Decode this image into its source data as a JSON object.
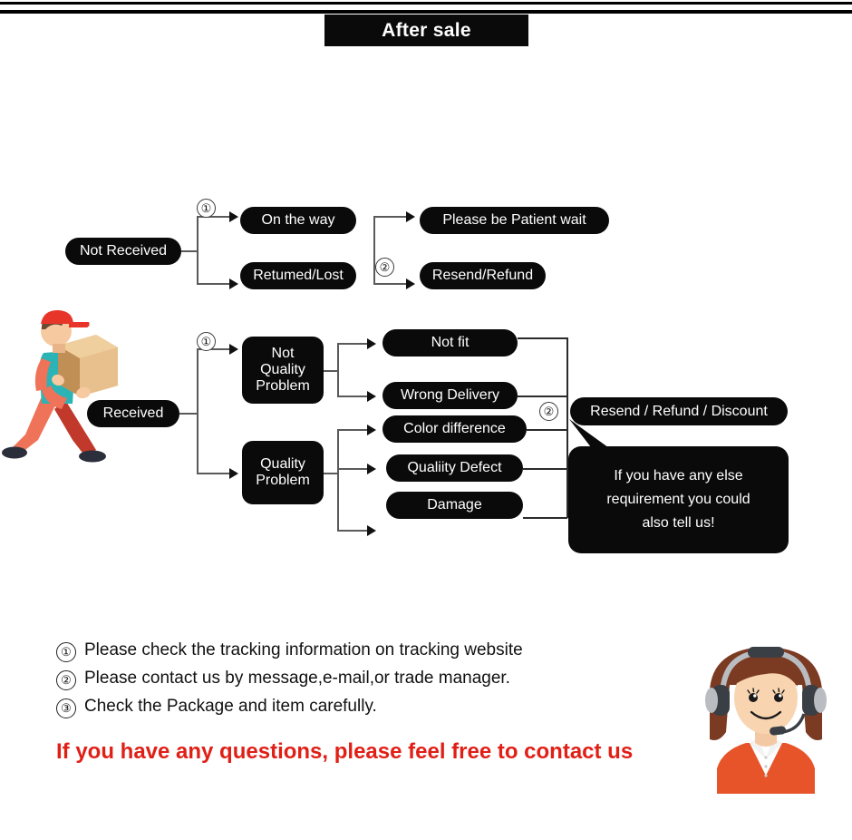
{
  "header": {
    "title": "After sale"
  },
  "flow": {
    "not_received": {
      "label": "Not Received",
      "marker": "①",
      "branches": [
        {
          "label": "On the way"
        },
        {
          "label": "Retumed/Lost"
        }
      ],
      "outcome_marker": "②",
      "outcomes": [
        {
          "label": "Please be Patient wait"
        },
        {
          "label": "Resend/Refund"
        }
      ]
    },
    "received": {
      "label": "Received",
      "marker": "①",
      "categories": [
        {
          "label": "Not Quality Problem",
          "lines": [
            "Not",
            "Quality",
            "Problem"
          ]
        },
        {
          "label": "Quality Problem",
          "lines": [
            "Quality",
            "Problem"
          ]
        }
      ],
      "not_quality_issues": [
        {
          "label": "Not fit"
        },
        {
          "label": "Wrong Delivery"
        }
      ],
      "quality_issues": [
        {
          "label": "Color difference"
        },
        {
          "label": "Qualiity Defect"
        },
        {
          "label": "Damage"
        }
      ],
      "resolution_marker": "②",
      "resolution": {
        "label": "Resend / Refund / Discount"
      }
    },
    "bubble": {
      "lines": [
        "If you have any else",
        "requirement you could",
        "also tell us!"
      ]
    }
  },
  "notes": [
    {
      "num": "①",
      "text": "Please check the tracking information on tracking website"
    },
    {
      "num": "②",
      "text": "Please contact us by message,e-mail,or trade manager."
    },
    {
      "num": "③",
      "text": "Check the Package and item carefully."
    }
  ],
  "cta": {
    "text": "If you have any questions, please feel free to contact us"
  },
  "icons": {
    "courier": "delivery-courier-illustration",
    "agent": "customer-service-agent-illustration"
  },
  "colors": {
    "node_bg": "#0a0a0a",
    "node_text": "#ffffff",
    "connector": "#5a5a5a",
    "cta_red": "#e01f16",
    "page_bg": "#ffffff"
  }
}
